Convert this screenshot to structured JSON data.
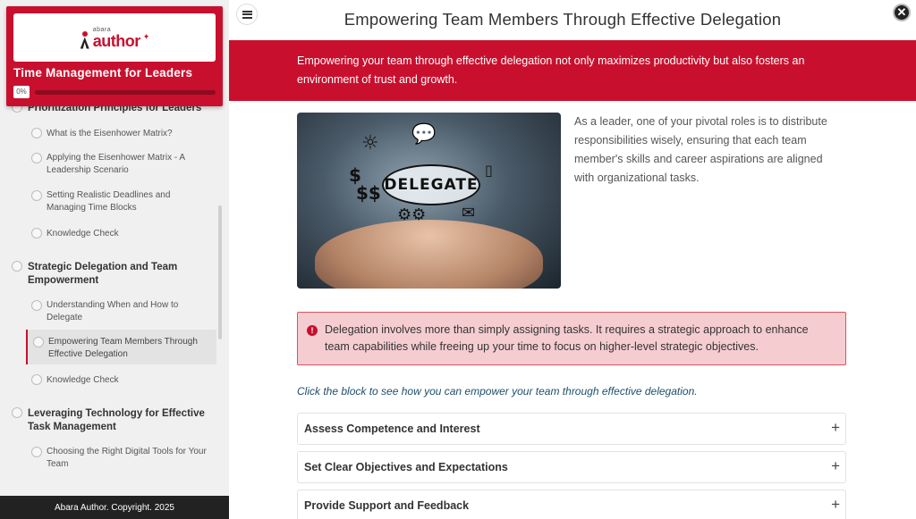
{
  "sidebar": {
    "logo": {
      "small": "abara",
      "big": "author"
    },
    "course_title": "Time Management for Leaders",
    "progress": {
      "label": "0%",
      "value": 0
    },
    "items": [
      {
        "type": "section",
        "label": "Prioritization Principles for Leaders"
      },
      {
        "type": "lesson",
        "label": "What is the Eisenhower Matrix?"
      },
      {
        "type": "lesson",
        "label": "Applying the Eisenhower Matrix - A Leadership Scenario"
      },
      {
        "type": "lesson",
        "label": "Setting Realistic Deadlines and Managing Time Blocks"
      },
      {
        "type": "lesson",
        "label": "Knowledge Check"
      },
      {
        "type": "section",
        "label": "Strategic Delegation and Team Empowerment"
      },
      {
        "type": "lesson",
        "label": "Understanding When and How to Delegate"
      },
      {
        "type": "lesson",
        "label": "Empowering Team Members Through Effective Delegation",
        "active": true
      },
      {
        "type": "lesson",
        "label": "Knowledge Check"
      },
      {
        "type": "section",
        "label": "Leveraging Technology for Effective Task Management"
      },
      {
        "type": "lesson",
        "label": "Choosing the Right Digital Tools for Your Team"
      }
    ],
    "footer": "Abara Author. Copyright. 2025"
  },
  "header": {
    "title": "Empowering Team Members Through Effective Delegation"
  },
  "banner": {
    "text": "Empowering your team through effective delegation not only maximizes productivity but also fosters an environment of trust and growth."
  },
  "hero_image": {
    "word": "DELEGATE"
  },
  "intro": {
    "text": "As a leader, one of your pivotal roles is to distribute responsibilities wisely, ensuring that each team member's skills and career aspirations are aligned with organizational tasks."
  },
  "alert": {
    "icon": "info-icon",
    "text": "Delegation involves more than simply assigning tasks. It requires a strategic approach to enhance team capabilities while freeing up your time to focus on higher-level strategic objectives."
  },
  "hint": "Click the block to see how you can empower your team through effective delegation.",
  "accordion": [
    {
      "label": "Assess Competence and Interest"
    },
    {
      "label": "Set Clear Objectives and Expectations"
    },
    {
      "label": "Provide Support and Feedback"
    }
  ],
  "colors": {
    "brand": "#c8102e",
    "alert_bg": "#f5cdd1",
    "footer_bg": "#222222"
  }
}
